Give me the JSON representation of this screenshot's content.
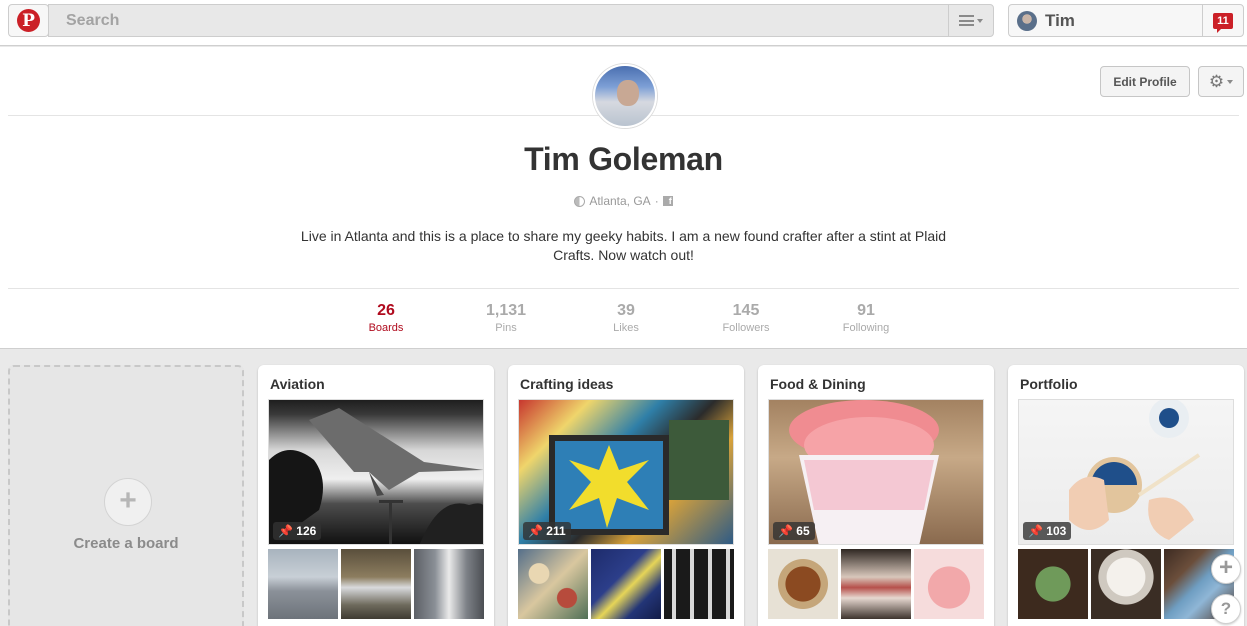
{
  "header": {
    "logo_letter": "P",
    "search_placeholder": "Search",
    "user_name": "Tim",
    "notification_count": "11"
  },
  "profile": {
    "name": "Tim Goleman",
    "location": "Atlanta, GA",
    "location_separator": "·",
    "facebook_glyph": "f",
    "bio": "Live in Atlanta and this is a place to share my geeky habits. I am a new found crafter after a stint at Plaid Crafts. Now watch out!",
    "edit_profile_label": "Edit Profile"
  },
  "stats": [
    {
      "value": "26",
      "label": "Boards",
      "active": true
    },
    {
      "value": "1,131",
      "label": "Pins",
      "active": false
    },
    {
      "value": "39",
      "label": "Likes",
      "active": false
    },
    {
      "value": "145",
      "label": "Followers",
      "active": false
    },
    {
      "value": "91",
      "label": "Following",
      "active": false
    }
  ],
  "create_board": {
    "plus": "+",
    "label": "Create a board"
  },
  "boards": [
    {
      "title": "Aviation",
      "pin_count": "126"
    },
    {
      "title": "Crafting ideas",
      "pin_count": "211"
    },
    {
      "title": "Food & Dining",
      "pin_count": "65"
    },
    {
      "title": "Portfolio",
      "pin_count": "103"
    }
  ],
  "floating": {
    "add": "+",
    "help": "?"
  },
  "colors": {
    "brand_red": "#cb2027",
    "active_stat": "#b00b1e",
    "background": "#e9e9e9"
  },
  "icons": [
    "pinterest-logo-icon",
    "menu-icon",
    "avatar",
    "notification-icon",
    "gear-icon",
    "globe-icon",
    "facebook-icon",
    "pin-icon",
    "plus-icon",
    "help-icon"
  ]
}
